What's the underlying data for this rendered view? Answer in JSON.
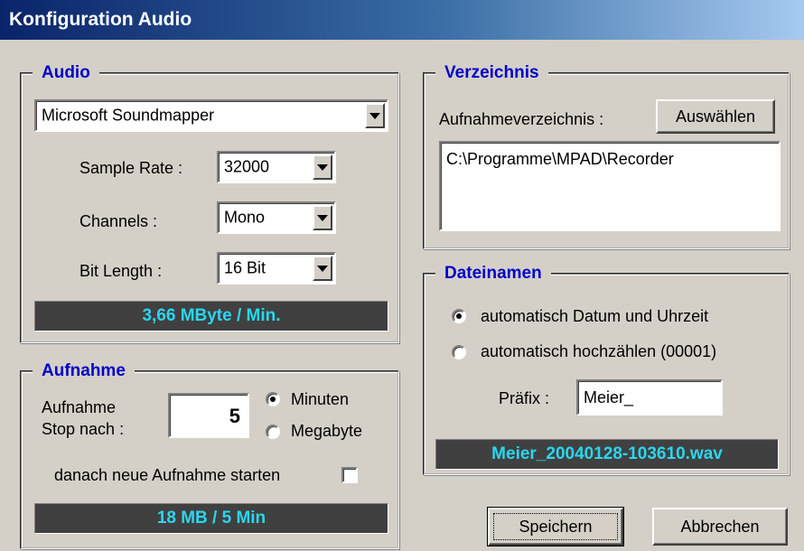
{
  "window": {
    "title": "Konfiguration Audio"
  },
  "audio": {
    "legend": "Audio",
    "device": "Microsoft Soundmapper",
    "sample_rate_label": "Sample Rate :",
    "sample_rate_value": "32000",
    "channels_label": "Channels :",
    "channels_value": "Mono",
    "bit_length_label": "Bit Length :",
    "bit_length_value": "16 Bit",
    "rate_display": "3,66 MByte / Min."
  },
  "aufnahme": {
    "legend": "Aufnahme",
    "stop_label_1": "Aufnahme",
    "stop_label_2": "Stop nach :",
    "stop_value": "5",
    "unit_minutes": "Minuten",
    "unit_megabyte": "Megabyte",
    "unit_selected": "Minuten",
    "restart_label": "danach neue Aufnahme starten",
    "restart_checked": false,
    "size_display": "18 MB / 5 Min"
  },
  "verzeichnis": {
    "legend": "Verzeichnis",
    "dir_label": "Aufnahmeverzeichnis :",
    "choose_button": "Auswählen",
    "path": "C:\\Programme\\MPAD\\Recorder"
  },
  "dateinamen": {
    "legend": "Dateinamen",
    "option_datetime": "automatisch Datum und Uhrzeit",
    "option_counter": "automatisch hochzählen (00001)",
    "selected": "automatisch Datum und Uhrzeit",
    "prefix_label": "Präfix :",
    "prefix_value": "Meier_",
    "filename_display": "Meier_20040128-103610.wav"
  },
  "buttons": {
    "save": "Speichern",
    "cancel": "Abbrechen"
  },
  "colors": {
    "display_text": "#2bd6f0",
    "legend_text": "#0000c8",
    "title_bar": "#0a246a"
  }
}
